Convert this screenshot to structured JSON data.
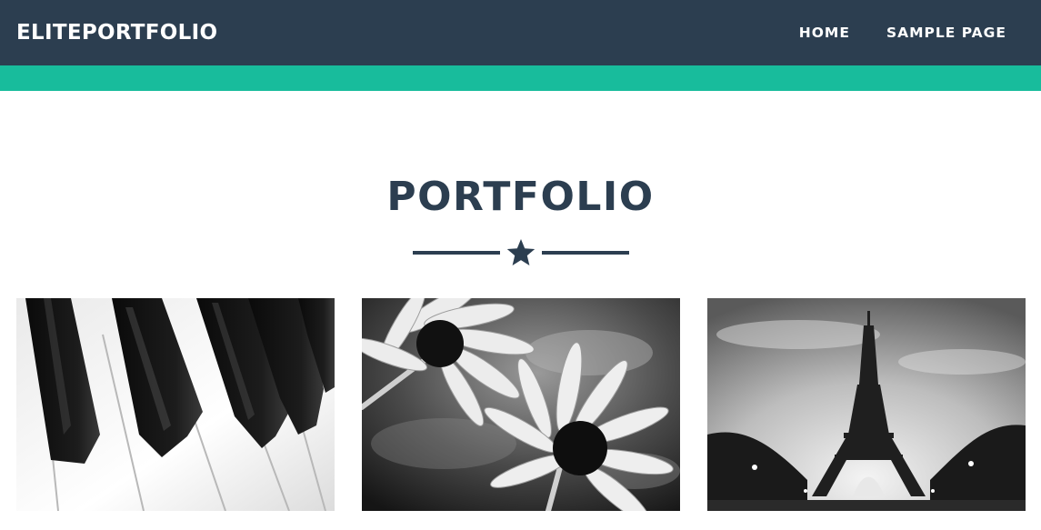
{
  "header": {
    "brand": "ELITEPORTFOLIO",
    "nav": [
      {
        "label": "HOME"
      },
      {
        "label": "SAMPLE PAGE"
      }
    ]
  },
  "colors": {
    "navbar": "#2c3e50",
    "accent": "#18bc9c",
    "title": "#2c3e50"
  },
  "portfolio": {
    "title": "PORTFOLIO",
    "divider_icon": "star-icon",
    "items": [
      {
        "image": "piano-keys-photo"
      },
      {
        "image": "daisy-flowers-photo"
      },
      {
        "image": "eiffel-tower-photo"
      }
    ]
  }
}
